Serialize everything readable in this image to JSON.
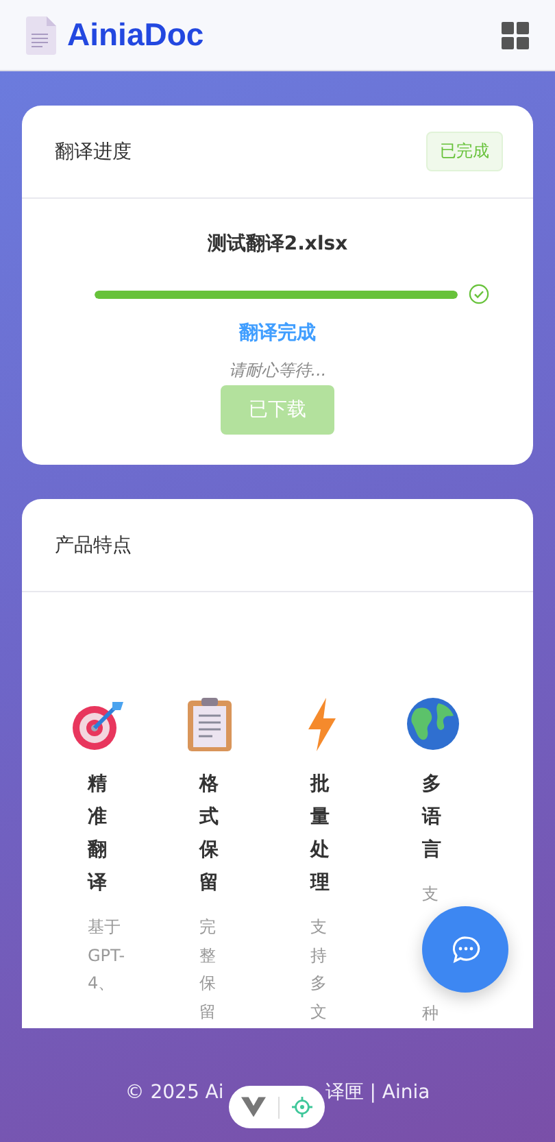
{
  "header": {
    "brand": "AiniaDoc"
  },
  "progress_card": {
    "title": "翻译进度",
    "badge": "已完成",
    "file_name": "测试翻译2.xlsx",
    "level": 1,
    "done": true,
    "status": "翻译完成",
    "hint": "请耐心等待...",
    "button": {
      "label": "已下载",
      "disabled": true
    }
  },
  "features_card": {
    "title": "产品特点",
    "features": [
      {
        "kind": "target",
        "title": "精准翻译",
        "description": [
          "基于GPT-4、"
        ]
      },
      {
        "kind": "clipboard",
        "title": "格式保留",
        "description": [
          "完整保留"
        ]
      },
      {
        "kind": "bolt",
        "title": "批量处理",
        "description": [
          "支持多文"
        ]
      },
      {
        "kind": "globe",
        "title": "多语言",
        "description": [
          "支",
          "种"
        ]
      }
    ]
  },
  "footer": {
    "parts": [
      "© 2025 Ai",
      "译匣 | Ainia"
    ]
  }
}
